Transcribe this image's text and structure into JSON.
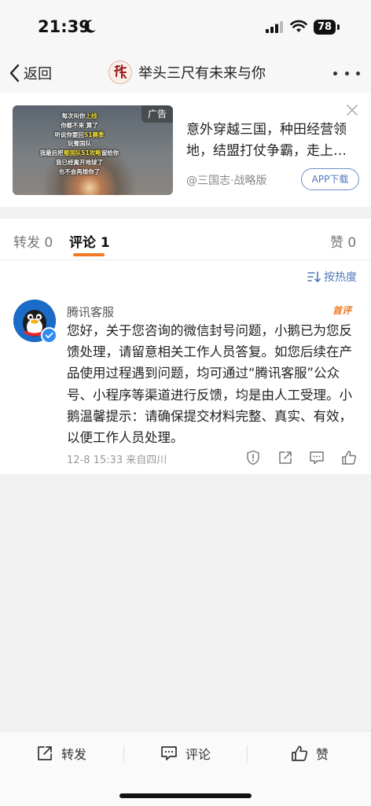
{
  "status_bar": {
    "time": "21:39",
    "battery": "78"
  },
  "nav": {
    "back_label": "返回",
    "title": "举头三尺有未来与你"
  },
  "ad": {
    "badge": "广告",
    "image_lines": [
      "每次叫你上线",
      "你都不来 算了",
      "听说你要回S1赛季",
      "玩蜀国队",
      "我最后把蜀国队S1攻略留给你",
      "我已经离开地球了",
      "也不会再烦你了"
    ],
    "title": "意外穿越三国，种田经营领地，结盟打仗争霸，走上…",
    "source": "@三国志·战略版",
    "download_label": "APP下载"
  },
  "tabs": {
    "forward": "转发 0",
    "comment": "评论 1",
    "like": "赞 0"
  },
  "sort_label": "按热度",
  "comment": {
    "author": "腾讯客服",
    "badge": "首评",
    "text": "您好，关于您咨询的微信封号问题，小鹅已为您反馈处理，请留意相关工作人员答复。如您后续在产品使用过程遇到问题，均可通过“腾讯客服”公众号、小程序等渠道进行反馈，均是由人工受理。小鹅温馨提示：请确保提交材料完整、真实、有效，以便工作人员处理。",
    "meta": "12-8 15:33 来自四川"
  },
  "bottom_bar": {
    "forward_label": "转发",
    "comment_label": "评论",
    "like_label": "赞"
  },
  "colors": {
    "accent": "#f07a24",
    "link_blue": "#4f78bb",
    "background": "#f2f2f2"
  },
  "icons": [
    "moon-icon",
    "signal-icon",
    "wifi-icon",
    "back-chevron-icon",
    "more-icon",
    "close-icon",
    "sort-icon",
    "report-icon",
    "share-icon",
    "reply-icon",
    "like-icon",
    "forward-icon",
    "comment-icon"
  ]
}
